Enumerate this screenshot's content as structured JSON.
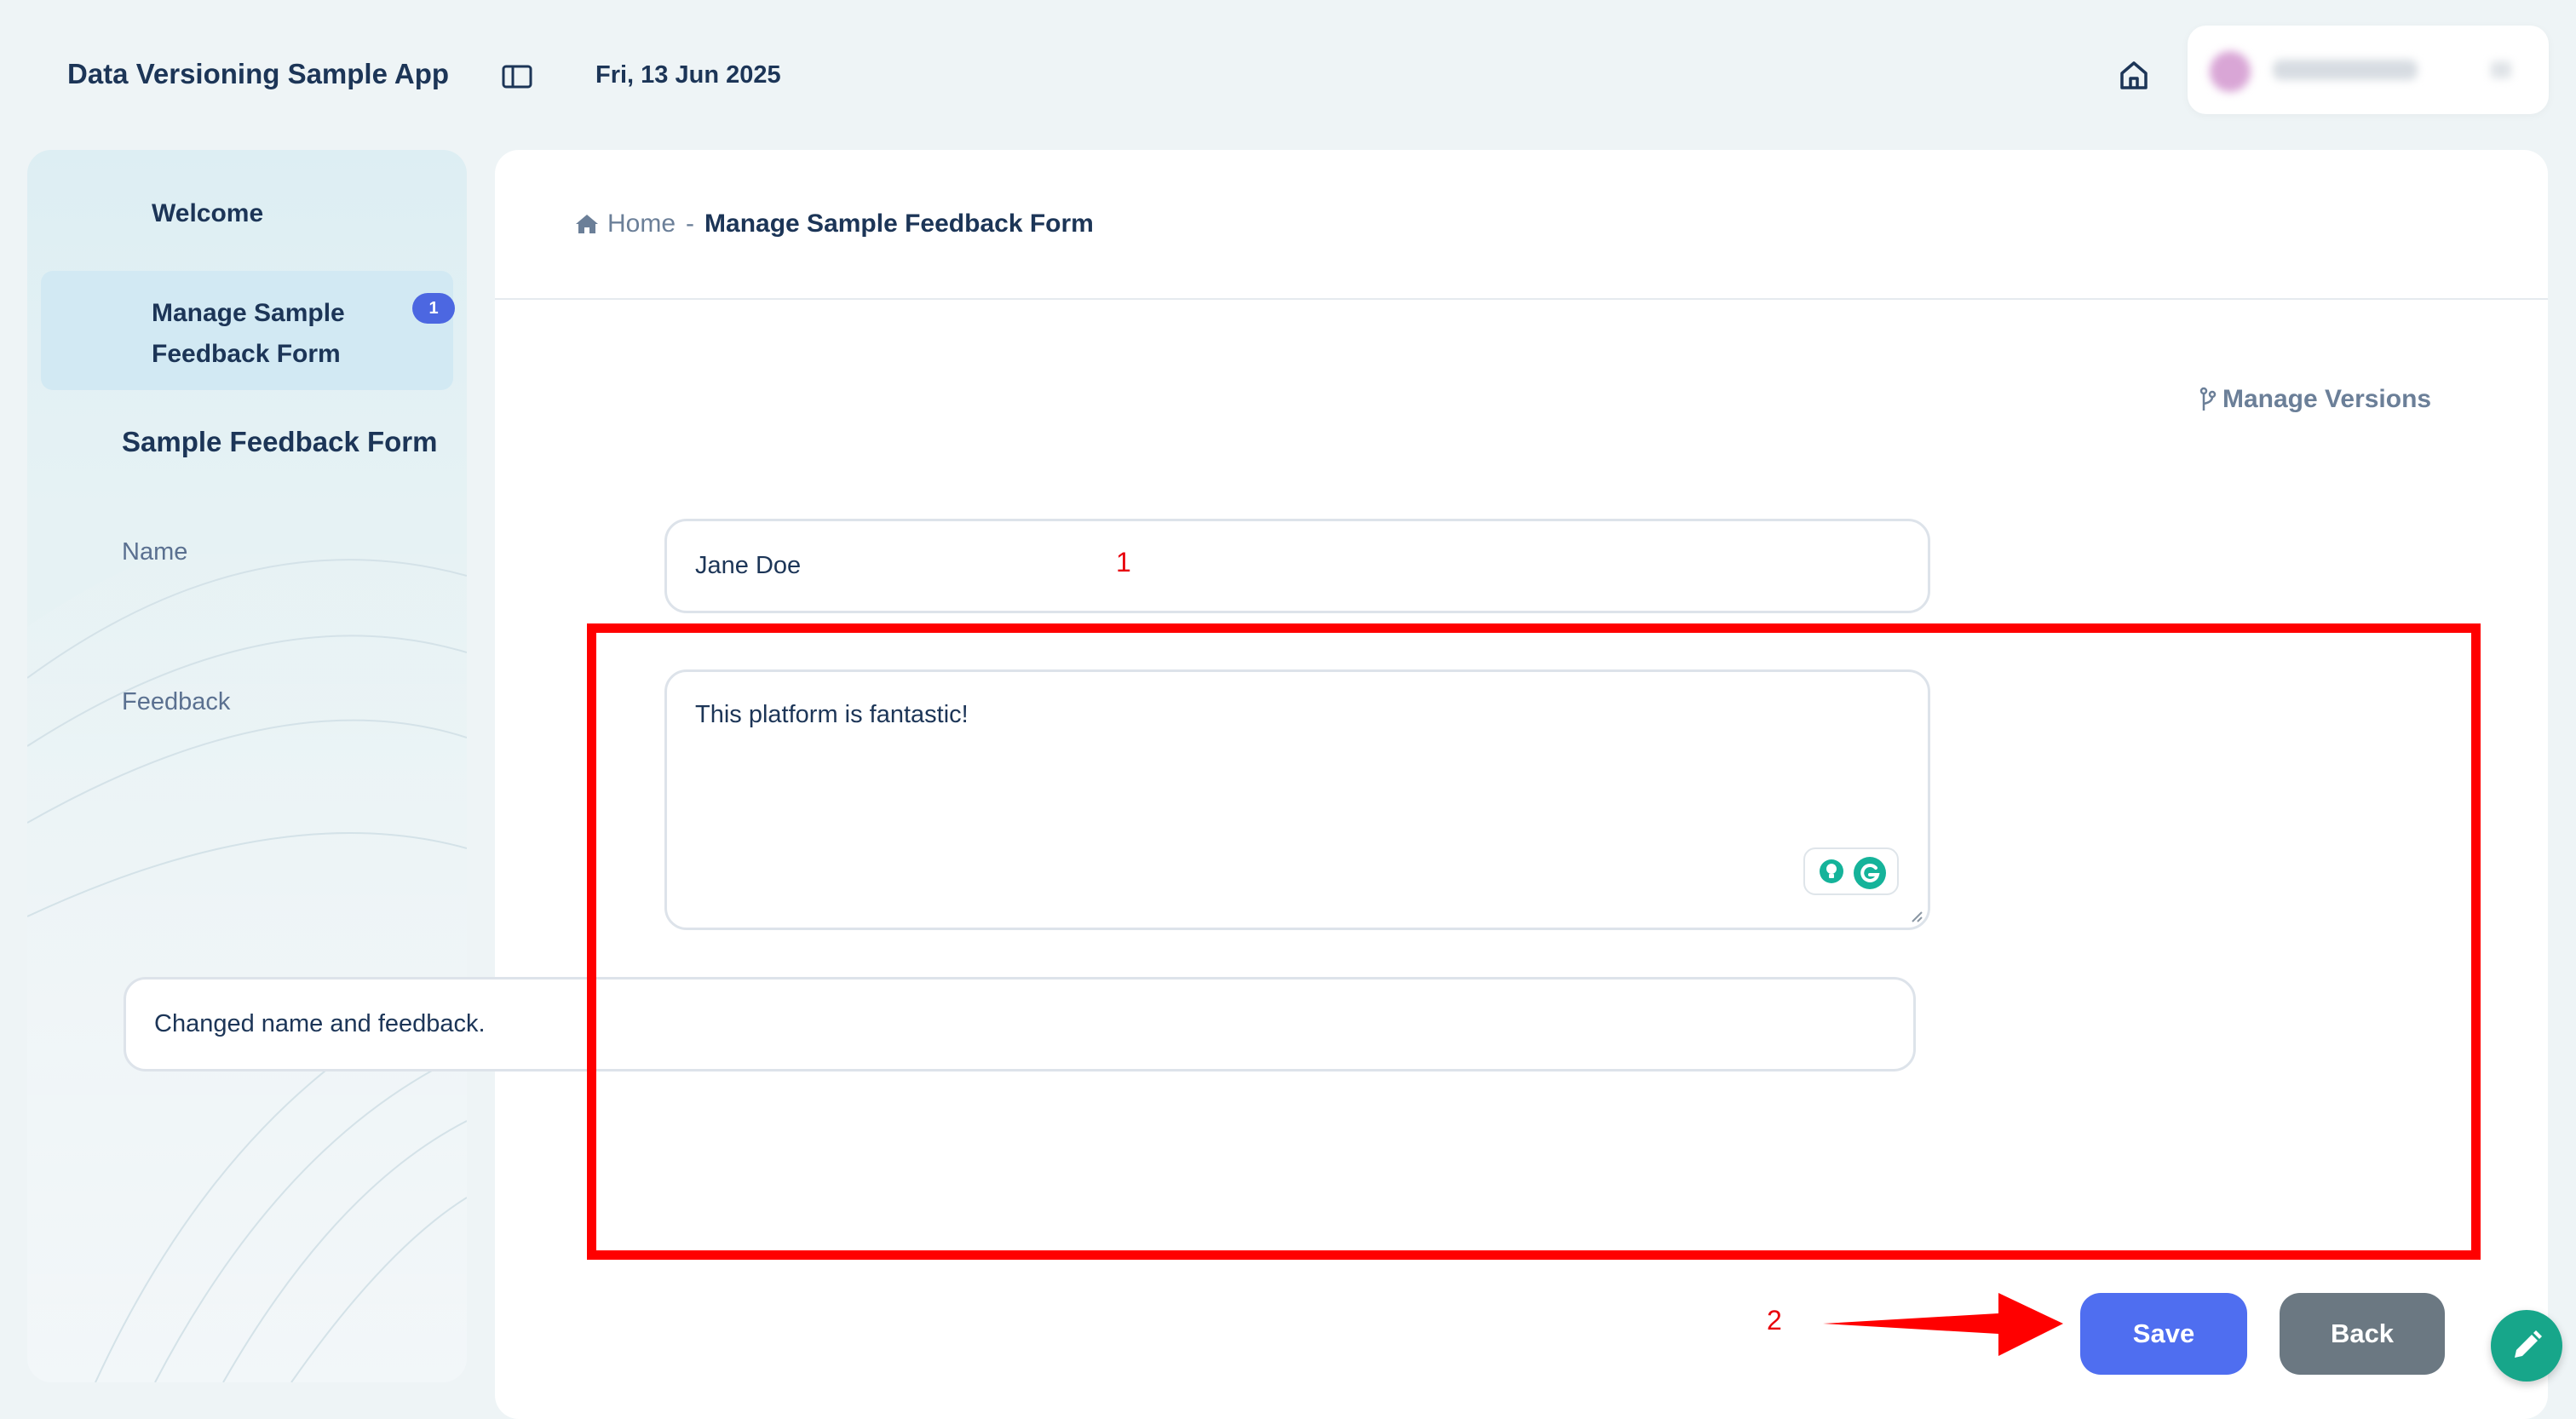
{
  "header": {
    "app_title": "Data Versioning Sample App",
    "date": "Fri, 13 Jun 2025",
    "icons": [
      "sidebar-toggle-icon",
      "home-icon"
    ]
  },
  "sidebar": {
    "items": [
      {
        "label": "Welcome"
      },
      {
        "label": "Manage Sample Feedback Form",
        "badge": "1"
      }
    ]
  },
  "breadcrumb": {
    "home": "Home",
    "separator": "-",
    "current": "Manage Sample Feedback Form"
  },
  "manage_versions": "Manage Versions",
  "form": {
    "title": "Sample Feedback Form",
    "name_label": "Name",
    "name_value": "Jane Doe",
    "feedback_label": "Feedback",
    "feedback_value": "This platform is fantastic!",
    "comment_value": "Changed name and feedback."
  },
  "buttons": {
    "save": "Save",
    "back": "Back"
  },
  "annotations": {
    "marker_1": "1",
    "marker_2": "2"
  },
  "colors": {
    "accent": "#4f6ef0",
    "back_button": "#6b7882",
    "annotation_red": "#ff0000",
    "fab": "#17a68a",
    "badge": "#4c67e1"
  }
}
